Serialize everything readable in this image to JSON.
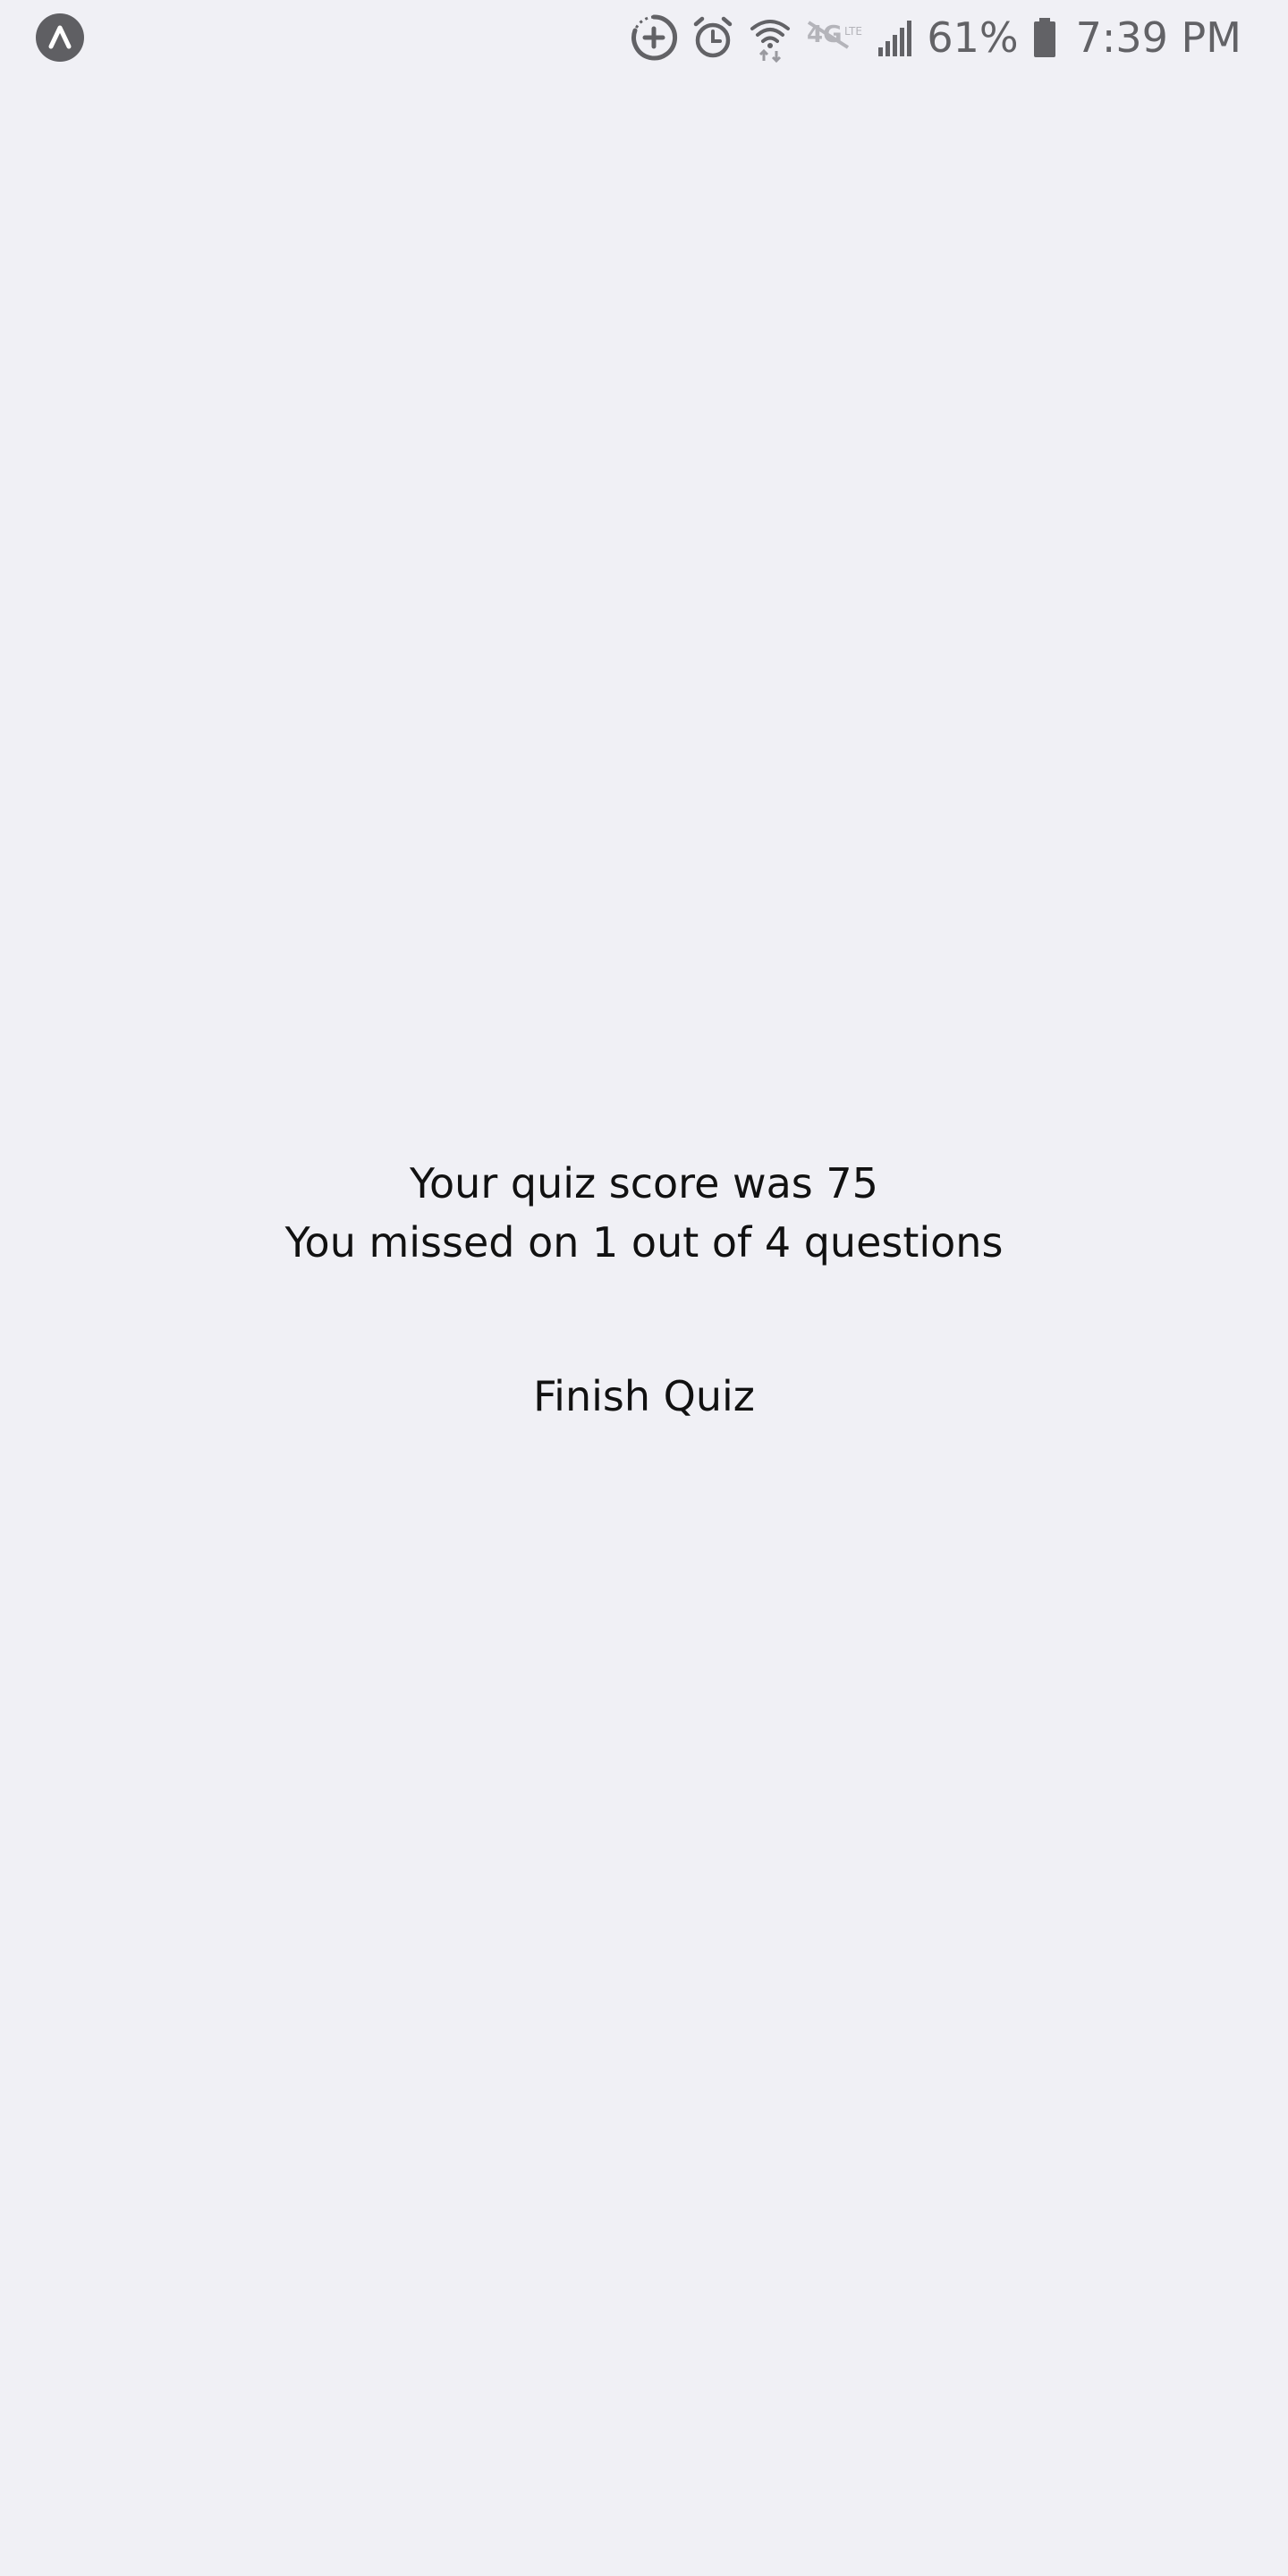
{
  "status_bar": {
    "app_icon": "expo-chevron-up-icon",
    "icons": [
      "sync-plus-icon",
      "alarm-clock-icon",
      "wifi-data-icon",
      "volte-disabled-icon",
      "cell-signal-icon",
      "battery-icon"
    ],
    "battery_percent": "61%",
    "time": "7:39 PM",
    "icon_color": "#626266"
  },
  "quiz_result": {
    "score_text": "Your quiz score was 75",
    "missed_text": "You missed on 1 out of 4 questions",
    "finish_label": "Finish Quiz"
  },
  "colors": {
    "background": "#f0f0f5",
    "text": "#111111"
  }
}
